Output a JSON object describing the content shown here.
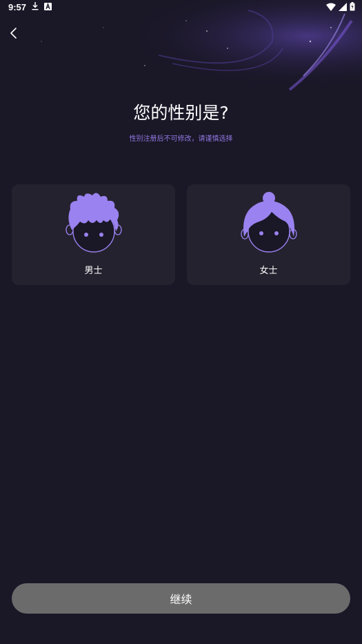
{
  "status_bar": {
    "time": "9:57",
    "left_icons": [
      "download-icon",
      "a-icon"
    ],
    "right_icons": [
      "wifi-icon",
      "signal-icon",
      "battery-icon"
    ]
  },
  "header": {
    "back_icon": "chevron-left-icon"
  },
  "main": {
    "title": "您的性别是?",
    "subtitle": "性别注册后不可修改，请谨慎选择",
    "options": [
      {
        "label": "男士",
        "icon": "male-avatar-icon"
      },
      {
        "label": "女士",
        "icon": "female-avatar-icon"
      }
    ]
  },
  "footer": {
    "continue_label": "继续"
  },
  "colors": {
    "background": "#1a1727",
    "card": "#25222f",
    "accent": "#9077e0",
    "avatar": "#9a82f0",
    "button": "#6b6b6b"
  }
}
